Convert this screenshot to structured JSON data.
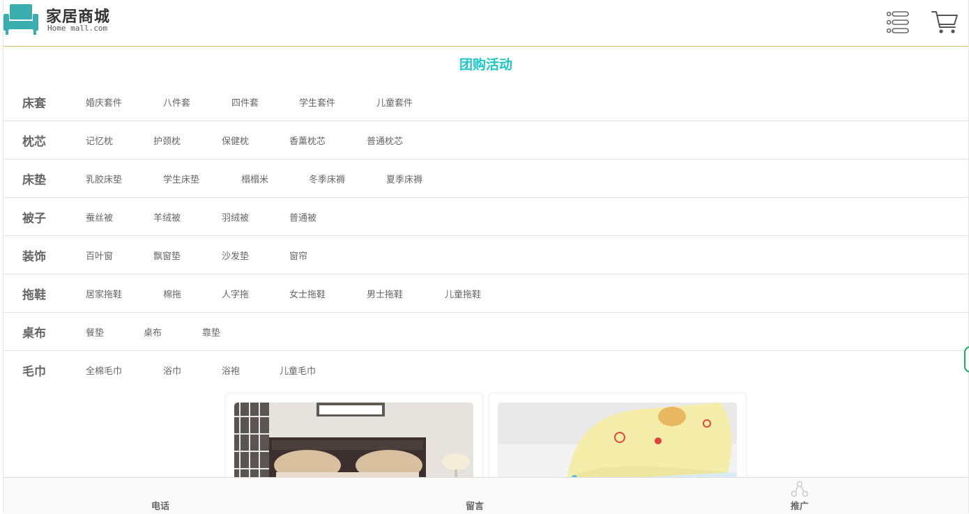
{
  "header": {
    "brand_title": "家居商城",
    "brand_subtitle": "Home mall.com",
    "menu_icon": "list-menu-icon",
    "cart_icon": "shopping-cart-icon"
  },
  "section_title": "团购活动",
  "categories": [
    {
      "name": "床套",
      "items": [
        "婚庆套件",
        "八件套",
        "四件套",
        "学生套件",
        "儿童套件"
      ]
    },
    {
      "name": "枕芯",
      "items": [
        "记忆枕",
        "护颈枕",
        "保健枕",
        "香薰枕芯",
        "普通枕芯"
      ]
    },
    {
      "name": "床垫",
      "items": [
        "乳胶床垫",
        "学生床垫",
        "榻榻米",
        "冬季床褥",
        "夏季床褥"
      ]
    },
    {
      "name": "被子",
      "items": [
        "蚕丝被",
        "羊绒被",
        "羽绒被",
        "普通被"
      ]
    },
    {
      "name": "装饰",
      "items": [
        "百叶窗",
        "飘窗垫",
        "沙发垫",
        "窗帘"
      ]
    },
    {
      "name": "拖鞋",
      "items": [
        "居家拖鞋",
        "棉拖",
        "人字拖",
        "女士拖鞋",
        "男士拖鞋",
        "儿童拖鞋"
      ]
    },
    {
      "name": "桌布",
      "items": [
        "餐垫",
        "桌布",
        "靠垫"
      ]
    },
    {
      "name": "毛巾",
      "items": [
        "全棉毛巾",
        "浴巾",
        "浴袍",
        "儿童毛巾"
      ]
    }
  ],
  "bottom_nav": {
    "phone": "电话",
    "message": "留言",
    "promote": "推广"
  },
  "colors": {
    "accent": "#1cc7c7",
    "logo": "#3aaeae",
    "header_border": "#d8c36a"
  }
}
